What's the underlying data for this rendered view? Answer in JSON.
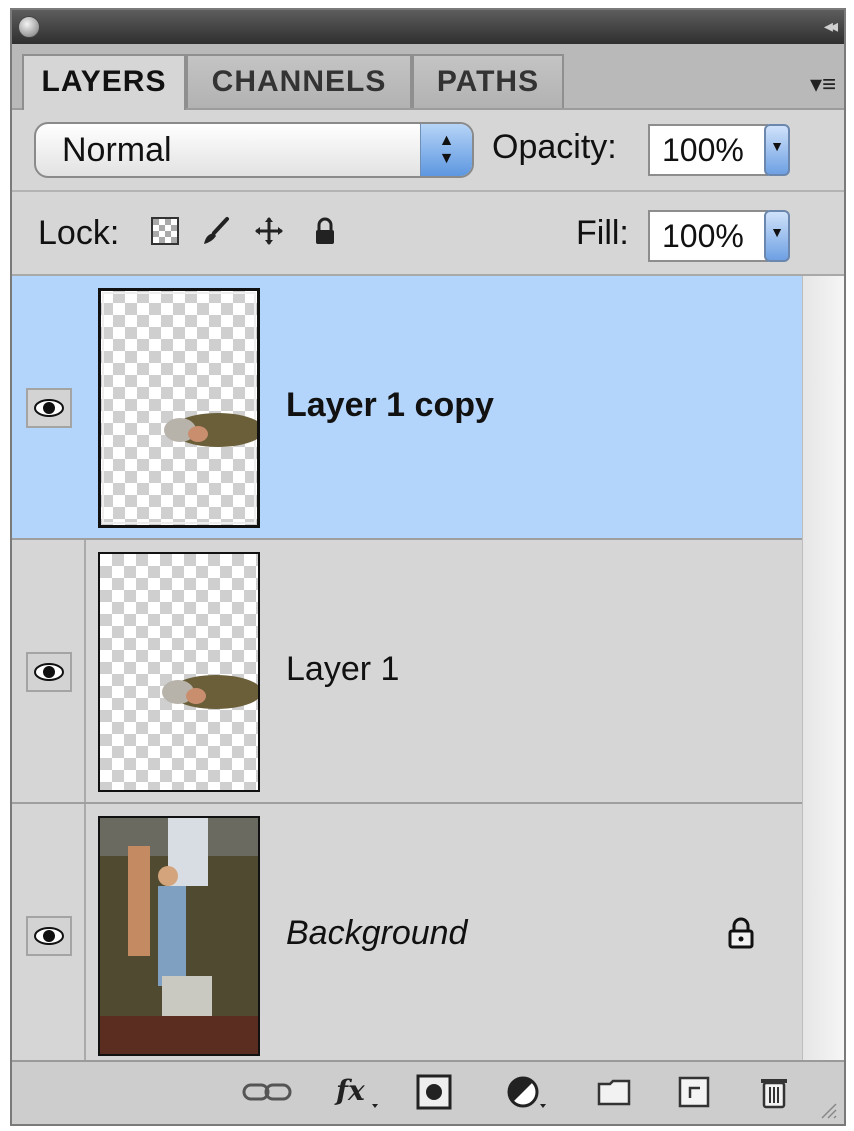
{
  "tabs": [
    {
      "label": "LAYERS",
      "active": true
    },
    {
      "label": "CHANNELS",
      "active": false
    },
    {
      "label": "PATHS",
      "active": false
    }
  ],
  "blend_mode": "Normal",
  "opacity": {
    "label": "Opacity:",
    "value": "100%"
  },
  "lock": {
    "label": "Lock:",
    "icons": [
      "lock-transparent-pixels-icon",
      "lock-image-pixels-icon",
      "lock-position-icon",
      "lock-all-icon"
    ]
  },
  "fill": {
    "label": "Fill:",
    "value": "100%"
  },
  "layers": [
    {
      "name": "Layer 1 copy",
      "selected": true,
      "visible": true,
      "locked": false
    },
    {
      "name": "Layer 1",
      "selected": false,
      "visible": true,
      "locked": false
    },
    {
      "name": "Background",
      "selected": false,
      "visible": true,
      "locked": true
    }
  ],
  "footer_icons": [
    "link-layers-icon",
    "layer-style-fx-icon",
    "add-mask-icon",
    "adjustment-layer-icon",
    "new-group-icon",
    "new-layer-icon",
    "delete-layer-icon"
  ],
  "colors": {
    "selection": "#b4d5fb",
    "panel": "#d6d6d6",
    "titlebar": "#3a3a3a"
  }
}
